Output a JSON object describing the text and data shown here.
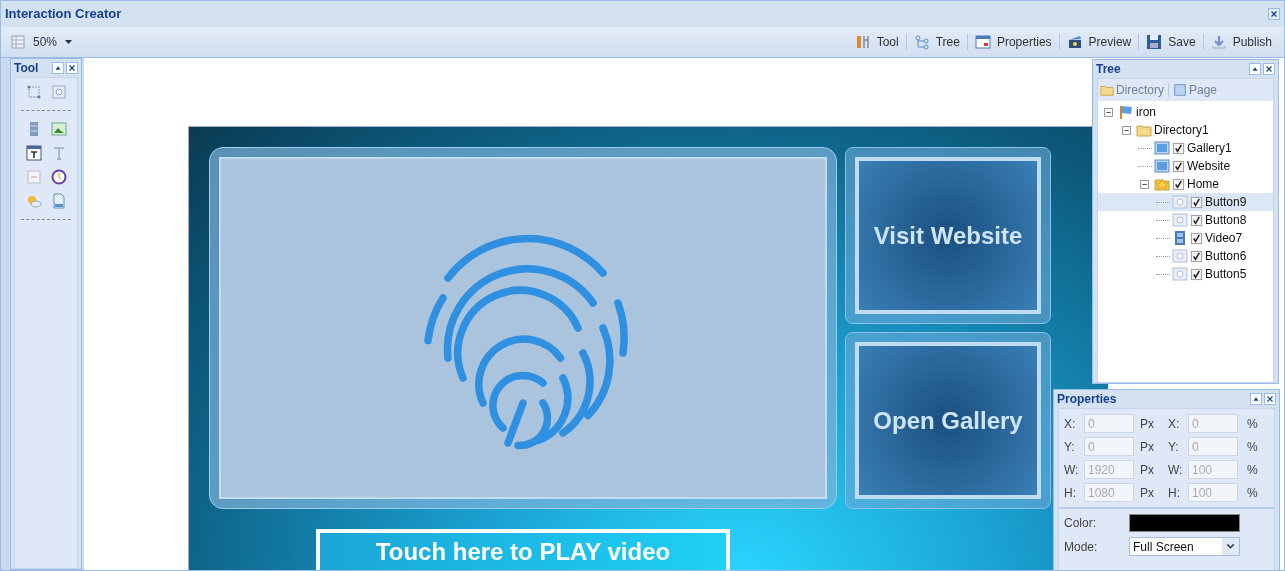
{
  "window": {
    "title": "Interaction Creator"
  },
  "toolbar": {
    "zoom": "50%",
    "buttons": [
      {
        "kind": "tool",
        "label": "Tool"
      },
      {
        "kind": "tree",
        "label": "Tree"
      },
      {
        "kind": "properties",
        "label": "Properties"
      },
      {
        "kind": "preview",
        "label": "Preview"
      },
      {
        "kind": "save",
        "label": "Save"
      },
      {
        "kind": "publish",
        "label": "Publish"
      }
    ]
  },
  "tool_panel": {
    "title": "Tool"
  },
  "stage": {
    "buttons": [
      {
        "label": "Visit Website"
      },
      {
        "label": "Open Gallery"
      }
    ],
    "play_button": "Touch here to PLAY video"
  },
  "tree_panel": {
    "title": "Tree",
    "buttons": [
      {
        "kind": "directory",
        "label": "Directory",
        "disabled": true
      },
      {
        "kind": "page",
        "label": "Page",
        "disabled": true
      }
    ],
    "nodes": [
      {
        "kind": "project",
        "label": "iron",
        "expanded": true,
        "selected": false,
        "children": [
          {
            "kind": "folder",
            "label": "Directory1",
            "expanded": true,
            "selected": false,
            "children": [
              {
                "kind": "page",
                "label": "Gallery1",
                "checked": true,
                "selected": false
              },
              {
                "kind": "page",
                "label": "Website",
                "checked": true,
                "selected": false
              },
              {
                "kind": "home",
                "label": "Home",
                "checked": true,
                "expanded": true,
                "selected": false,
                "children": [
                  {
                    "kind": "button",
                    "label": "Button9",
                    "checked": true,
                    "selected": true
                  },
                  {
                    "kind": "button",
                    "label": "Button8",
                    "checked": true,
                    "selected": false
                  },
                  {
                    "kind": "video",
                    "label": "Video7",
                    "checked": true,
                    "selected": false
                  },
                  {
                    "kind": "button",
                    "label": "Button6",
                    "checked": true,
                    "selected": false
                  },
                  {
                    "kind": "button",
                    "label": "Button5",
                    "checked": true,
                    "selected": false
                  }
                ]
              }
            ]
          }
        ]
      }
    ]
  },
  "properties_panel": {
    "title": "Properties",
    "rows": [
      {
        "label": "X:",
        "px_value": "0",
        "px_unit": "Px",
        "pct_label": "X:",
        "pct_value": "0",
        "pct_unit": "%"
      },
      {
        "label": "Y:",
        "px_value": "0",
        "px_unit": "Px",
        "pct_label": "Y:",
        "pct_value": "0",
        "pct_unit": "%"
      },
      {
        "label": "W:",
        "px_value": "1920",
        "px_unit": "Px",
        "pct_label": "W:",
        "pct_value": "100",
        "pct_unit": "%"
      },
      {
        "label": "H:",
        "px_value": "1080",
        "px_unit": "Px",
        "pct_label": "H:",
        "pct_value": "100",
        "pct_unit": "%"
      }
    ],
    "color": {
      "label": "Color:",
      "color": "#000000"
    },
    "mode": {
      "label": "Mode:",
      "value": "Full Screen"
    }
  }
}
